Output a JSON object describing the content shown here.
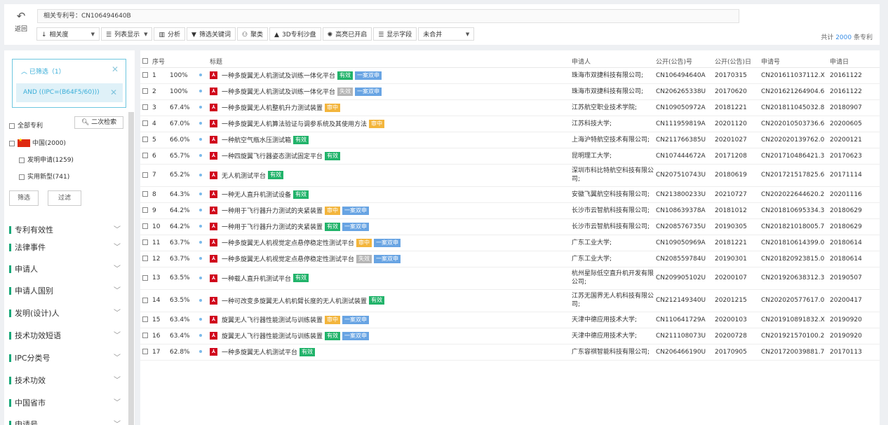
{
  "topbar": {
    "back_label": "返回",
    "related_label": "相关专利号：CN106494640B",
    "toolbar": [
      {
        "name": "sort",
        "icon": "↓",
        "label": "相关度",
        "dropdown": true,
        "w": "w1"
      },
      {
        "name": "view",
        "icon": "☰",
        "label": "列表显示",
        "dropdown": true,
        "w": ""
      },
      {
        "name": "analysis",
        "icon": "▥",
        "label": "分析",
        "dropdown": false,
        "w": ""
      },
      {
        "name": "keywords",
        "icon": "▼",
        "label": "筛选关键词",
        "dropdown": false,
        "w": ""
      },
      {
        "name": "cluster",
        "icon": "⚇",
        "label": "聚类",
        "dropdown": false,
        "w": ""
      },
      {
        "name": "sandbox",
        "icon": "▲",
        "label": "3D专利沙盘",
        "dropdown": false,
        "w": ""
      },
      {
        "name": "highlight",
        "icon": "✺",
        "label": "高亮已开启",
        "dropdown": false,
        "w": ""
      },
      {
        "name": "fields",
        "icon": "☰",
        "label": "显示字段",
        "dropdown": false,
        "w": ""
      },
      {
        "name": "merge",
        "icon": "",
        "label": "未合并",
        "dropdown": true,
        "w": "w3"
      }
    ],
    "total_prefix": "共计",
    "total_count": "2000",
    "total_suffix": "条专利"
  },
  "sidebar": {
    "filter_header": "已筛选（1）",
    "filter_chip": "AND ((IPC=(B64F5/60)))",
    "all_patents": "全部专利",
    "secondary_search": "二次检索",
    "china": "中国(2000)",
    "invention": "发明申请(1259)",
    "utility": "实用新型(741)",
    "screen_btn": "筛选",
    "filter_btn": "过滤",
    "sections": [
      "专利有效性",
      "法律事件",
      "申请人",
      "申请人国别",
      "发明(设计)人",
      "技术功效短语",
      "IPC分类号",
      "技术功效",
      "中国省市",
      "申请号"
    ]
  },
  "table": {
    "headers": {
      "no": "序号",
      "title": "标题",
      "applicant": "申请人",
      "pubno": "公开(公告)号",
      "pubdate": "公开(公告)日",
      "appno": "申请号",
      "appdate": "申请日"
    },
    "tag_labels": {
      "valid": "有效",
      "expired": "失效",
      "review": "审中",
      "dual": "一案双申"
    },
    "rows": [
      {
        "no": "1",
        "score": "100%",
        "title": "一种多旋翼无人机测试及训练一体化平台",
        "tags": [
          "valid",
          "dual"
        ],
        "applicant": "珠海市双捷科技有限公司;",
        "pubno": "CN106494640A",
        "pubdate": "20170315",
        "appno": "CN201611037112.X",
        "appdate": "20161122",
        "tall": false
      },
      {
        "no": "2",
        "score": "100%",
        "title": "一种多旋翼无人机测试及训练一体化平台",
        "tags": [
          "expired",
          "dual"
        ],
        "applicant": "珠海市双捷科技有限公司;",
        "pubno": "CN206265338U",
        "pubdate": "20170620",
        "appno": "CN201621264904.6",
        "appdate": "20161122",
        "tall": false
      },
      {
        "no": "3",
        "score": "67.4%",
        "title": "一种多旋翼无人机整机升力测试装置",
        "tags": [
          "review"
        ],
        "applicant": "江苏航空职业技术学院;",
        "pubno": "CN109050972A",
        "pubdate": "20181221",
        "appno": "CN201811045032.8",
        "appdate": "20180907",
        "tall": false
      },
      {
        "no": "4",
        "score": "67.0%",
        "title": "一种多旋翼无人机算法验证与调参系统及其使用方法",
        "tags": [
          "review"
        ],
        "applicant": "江苏科技大学;",
        "pubno": "CN111959819A",
        "pubdate": "20201120",
        "appno": "CN202010503736.6",
        "appdate": "20200605",
        "tall": false
      },
      {
        "no": "5",
        "score": "66.0%",
        "title": "一种航空气瓶水压测试箱",
        "tags": [
          "valid"
        ],
        "applicant": "上海沪特航空技术有限公司;",
        "pubno": "CN211766385U",
        "pubdate": "20201027",
        "appno": "CN202020139762.0",
        "appdate": "20200121",
        "tall": false
      },
      {
        "no": "6",
        "score": "65.7%",
        "title": "一种四旋翼飞行器姿态测试固定平台",
        "tags": [
          "valid"
        ],
        "applicant": "昆明理工大学;",
        "pubno": "CN107444672A",
        "pubdate": "20171208",
        "appno": "CN201710486421.3",
        "appdate": "20170623",
        "tall": false
      },
      {
        "no": "7",
        "score": "65.2%",
        "title": "无人机测试平台",
        "tags": [
          "valid"
        ],
        "applicant": "深圳市科比特航空科技有限公司;",
        "pubno": "CN207510743U",
        "pubdate": "20180619",
        "appno": "CN201721517825.6",
        "appdate": "20171114",
        "tall": true
      },
      {
        "no": "8",
        "score": "64.3%",
        "title": "一种无人直升机测试设备",
        "tags": [
          "valid"
        ],
        "applicant": "安徽飞翼航空科技有限公司;",
        "pubno": "CN213800233U",
        "pubdate": "20210727",
        "appno": "CN202022644620.2",
        "appdate": "20201116",
        "tall": false
      },
      {
        "no": "9",
        "score": "64.2%",
        "title": "一种用于飞行器升力测试的夹紧装置",
        "tags": [
          "review",
          "dual"
        ],
        "applicant": "长沙市云智航科技有限公司;",
        "pubno": "CN108639378A",
        "pubdate": "20181012",
        "appno": "CN201810695334.3",
        "appdate": "20180629",
        "tall": false
      },
      {
        "no": "10",
        "score": "64.2%",
        "title": "一种用于飞行器升力测试的夹紧装置",
        "tags": [
          "valid",
          "dual"
        ],
        "applicant": "长沙市云智航科技有限公司;",
        "pubno": "CN208576735U",
        "pubdate": "20190305",
        "appno": "CN201821018005.7",
        "appdate": "20180629",
        "tall": false
      },
      {
        "no": "11",
        "score": "63.7%",
        "title": "一种多旋翼无人机视觉定点悬停稳定性测试平台",
        "tags": [
          "review",
          "dual"
        ],
        "applicant": "广东工业大学;",
        "pubno": "CN109050969A",
        "pubdate": "20181221",
        "appno": "CN201810614399.0",
        "appdate": "20180614",
        "tall": false
      },
      {
        "no": "12",
        "score": "63.7%",
        "title": "一种多旋翼无人机视觉定点悬停稳定性测试平台",
        "tags": [
          "expired",
          "dual"
        ],
        "applicant": "广东工业大学;",
        "pubno": "CN208559784U",
        "pubdate": "20190301",
        "appno": "CN201820923815.0",
        "appdate": "20180614",
        "tall": false
      },
      {
        "no": "13",
        "score": "63.5%",
        "title": "一种载人直升机测试平台",
        "tags": [
          "valid"
        ],
        "applicant": "杭州星际低空直升机开发有限公司;",
        "pubno": "CN209905102U",
        "pubdate": "20200107",
        "appno": "CN201920638312.3",
        "appdate": "20190507",
        "tall": true
      },
      {
        "no": "14",
        "score": "63.5%",
        "title": "一种可改变多旋翼无人机机臂长度的无人机测试装置",
        "tags": [
          "valid"
        ],
        "applicant": "江苏无国界无人机科技有限公司;",
        "pubno": "CN212149340U",
        "pubdate": "20201215",
        "appno": "CN202020577617.0",
        "appdate": "20200417",
        "tall": true
      },
      {
        "no": "15",
        "score": "63.4%",
        "title": "旋翼无人飞行器性能测试与训练装置",
        "tags": [
          "review",
          "dual"
        ],
        "applicant": "天津中德应用技术大学;",
        "pubno": "CN110641729A",
        "pubdate": "20200103",
        "appno": "CN201910891832.X",
        "appdate": "20190920",
        "tall": false
      },
      {
        "no": "16",
        "score": "63.4%",
        "title": "旋翼无人飞行器性能测试与训练装置",
        "tags": [
          "valid",
          "dual"
        ],
        "applicant": "天津中德应用技术大学;",
        "pubno": "CN211108073U",
        "pubdate": "20200728",
        "appno": "CN201921570100.2",
        "appdate": "20190920",
        "tall": false
      },
      {
        "no": "17",
        "score": "62.8%",
        "title": "一种多旋翼无人机测试平台",
        "tags": [
          "valid"
        ],
        "applicant": "广东容祺智能科技有限公司;",
        "pubno": "CN206466190U",
        "pubdate": "20170905",
        "appno": "CN201720039881.7",
        "appdate": "20170113",
        "tall": false
      }
    ]
  }
}
